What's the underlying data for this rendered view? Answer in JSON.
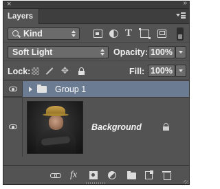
{
  "panel": {
    "close_glyph": "×",
    "collapse_glyph": "»",
    "tab_label": "Layers",
    "menu_icon": "panel-menu-icon"
  },
  "filter": {
    "kind_label": "Kind",
    "filter_icons": [
      "image-filter-icon",
      "adjustment-filter-icon",
      "type-filter-icon",
      "shape-filter-icon",
      "smart-object-filter-icon"
    ],
    "type_glyph": "T"
  },
  "blend": {
    "mode": "Soft Light",
    "opacity_label": "Opacity:",
    "opacity_value": "100%"
  },
  "lock": {
    "label": "Lock:",
    "move_glyph": "✥",
    "fill_label": "Fill:",
    "fill_value": "100%"
  },
  "layers": [
    {
      "name": "Group 1",
      "type": "group",
      "visible": true,
      "selected": true
    },
    {
      "name": "Background",
      "type": "image",
      "visible": true,
      "locked": true
    }
  ],
  "bottom": {
    "fx_label": "fx",
    "icons": [
      "link-icon",
      "fx-icon",
      "mask-icon",
      "adjustment-icon",
      "folder-icon",
      "new-layer-icon",
      "trash-icon"
    ]
  },
  "colors": {
    "panel_bg": "#535353",
    "selected_layer": "#6a7b92",
    "field_bg": "#6b6b6b"
  }
}
